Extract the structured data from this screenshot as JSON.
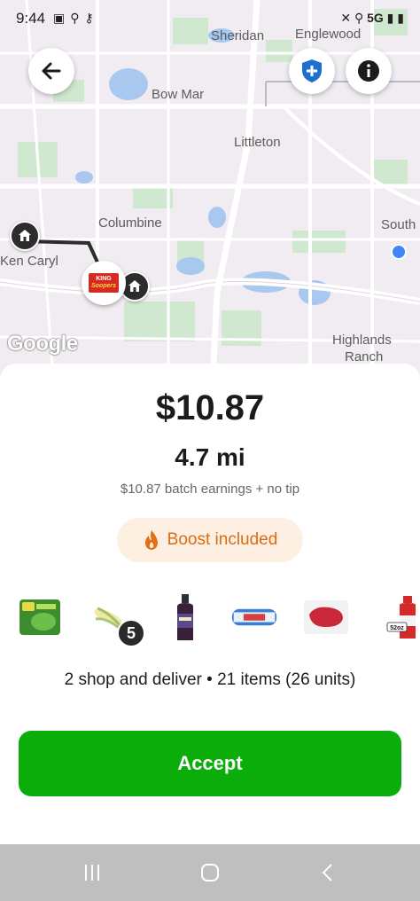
{
  "status_bar": {
    "time": "9:44",
    "left_icons": [
      "calendar-icon",
      "location-icon",
      "key-icon"
    ],
    "network": "5G",
    "right_icons": [
      "mute-icon",
      "location-icon",
      "signal-icon",
      "battery-icon"
    ]
  },
  "map": {
    "labels": {
      "sheridan": "Sheridan",
      "englewood": "Englewood",
      "bow_mar": "Bow Mar",
      "littleton": "Littleton",
      "columbine": "Columbine",
      "ken_caryl": "Ken Caryl",
      "south": "South",
      "highlands": "Highlands",
      "ranch": "Ranch"
    },
    "google_logo": "Google",
    "store_logo_line1": "KING",
    "store_logo_line2": "Soopers",
    "colors": {
      "route": "#2c2c2c",
      "water": "#a8c8f0",
      "park": "#cfe8cf",
      "road": "#ffffff",
      "location_dot": "#4285f4"
    }
  },
  "offer": {
    "price": "$10.87",
    "distance": "4.7 mi",
    "earnings_note": "$10.87 batch earnings + no tip",
    "boost_label": "Boost included",
    "products": [
      {
        "icon": "salad-bag-icon"
      },
      {
        "icon": "corn-icon",
        "quantity": "5"
      },
      {
        "icon": "balsamic-bottle-icon"
      },
      {
        "icon": "dough-can-icon"
      },
      {
        "icon": "steak-icon"
      },
      {
        "icon": "sauce-bottle-icon",
        "size_label": "52oz"
      }
    ],
    "summary": "2 shop and deliver • 21 items (26 units)",
    "accept_label": "Accept"
  },
  "colors": {
    "accept_green": "#0aad0a",
    "boost_orange": "#d96d15",
    "boost_bg": "#fdf0e2",
    "shield_blue": "#1f6fd1"
  }
}
